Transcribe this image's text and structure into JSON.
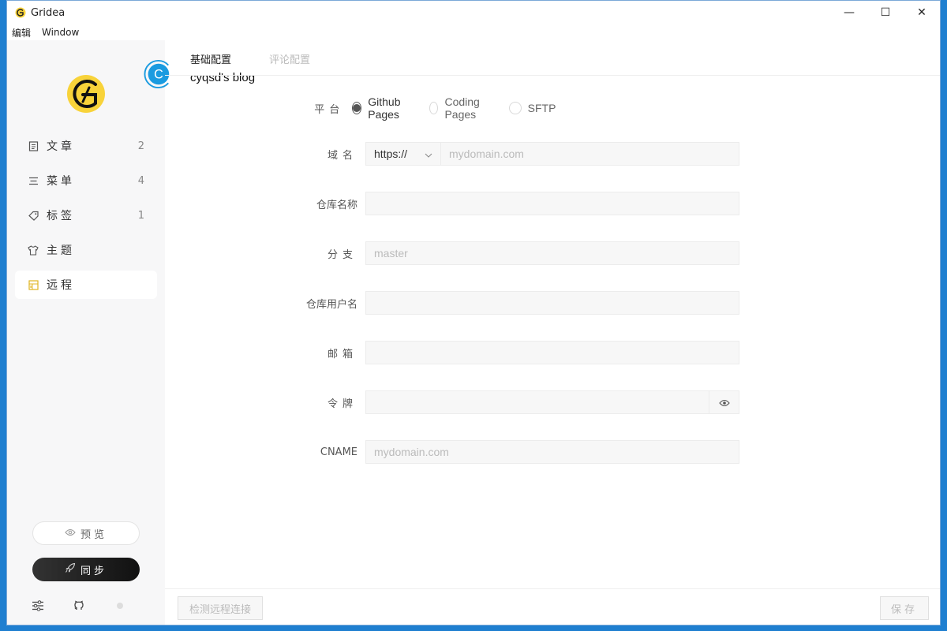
{
  "window": {
    "title": "Gridea",
    "controls": {
      "minimize": "—",
      "maximize": "☐",
      "close": "✕"
    }
  },
  "menubar": {
    "items": [
      "编辑",
      "Window"
    ]
  },
  "sidebar": {
    "items": [
      {
        "label": "文章",
        "count": "2",
        "icon": "document-icon"
      },
      {
        "label": "菜单",
        "count": "4",
        "icon": "menu-icon"
      },
      {
        "label": "标签",
        "count": "1",
        "icon": "tag-icon"
      },
      {
        "label": "主题",
        "count": "",
        "icon": "shirt-icon"
      },
      {
        "label": "远程",
        "count": "",
        "icon": "remote-icon"
      }
    ],
    "active_index": 4,
    "preview_label": "预览",
    "sync_label": "同步"
  },
  "main": {
    "tabs": [
      {
        "label": "基础配置",
        "active": true
      },
      {
        "label": "评论配置",
        "active": false
      }
    ],
    "site_title": "cyqsd's blog",
    "site_avatar_letter": "C"
  },
  "form": {
    "platform": {
      "label": "平台",
      "options": [
        "Github Pages",
        "Coding Pages",
        "SFTP"
      ],
      "selected": "Github Pages"
    },
    "domain": {
      "label": "域名",
      "protocol": "https://",
      "placeholder": "mydomain.com",
      "value": ""
    },
    "repo": {
      "label": "仓库名称",
      "value": ""
    },
    "branch": {
      "label": "分支",
      "placeholder": "master",
      "value": ""
    },
    "username": {
      "label": "仓库用户名",
      "value": ""
    },
    "email": {
      "label": "邮箱",
      "value": ""
    },
    "token": {
      "label": "令牌",
      "value": ""
    },
    "cname": {
      "label": "CNAME",
      "placeholder": "mydomain.com",
      "value": ""
    }
  },
  "footer": {
    "check_label": "检测远程连接",
    "save_label": "保存"
  },
  "colors": {
    "accent_yellow": "#f8d33a",
    "avatar_blue": "#1a9be0",
    "dark_button": "#1a1a1a"
  }
}
